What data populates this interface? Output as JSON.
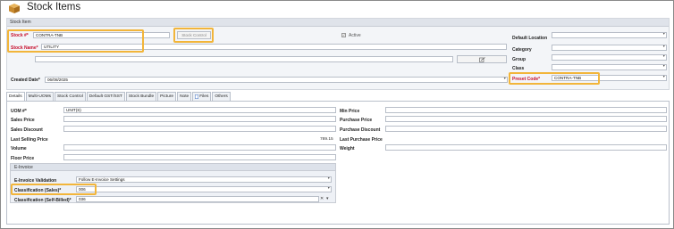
{
  "window": {
    "title": "Stock Items"
  },
  "panel": {
    "header": "Stock Item"
  },
  "fields": {
    "stock_no": {
      "label": "Stock #*",
      "value": "CONTRA-TNB"
    },
    "stock_name": {
      "label": "Stock Name*",
      "value": "UTILITY"
    },
    "stock_control_button": "Stock Control",
    "active": {
      "label": "Active",
      "checked": true
    },
    "created_date": {
      "label": "Created Date*",
      "value": "06/08/2025"
    },
    "default_location": {
      "label": "Default Location",
      "value": ""
    },
    "category": {
      "label": "Category",
      "value": ""
    },
    "group": {
      "label": "Group",
      "value": ""
    },
    "class": {
      "label": "Class",
      "value": ""
    },
    "preset_code": {
      "label": "Preset Code*",
      "value": "CONTRA-TNB"
    }
  },
  "tabs": [
    {
      "label": "Details",
      "active": true
    },
    {
      "label": "Multi-UOMs"
    },
    {
      "label": "Stock Control"
    },
    {
      "label": "Default GST/SST"
    },
    {
      "label": "Stock Bundle"
    },
    {
      "label": "Picture"
    },
    {
      "label": "Note"
    },
    {
      "label": "Files",
      "icon": "file-icon"
    },
    {
      "label": "Others"
    }
  ],
  "details": {
    "left": [
      {
        "label": "UOM #*",
        "value": "UNIT(S)"
      },
      {
        "label": "Sales Price",
        "value": ""
      },
      {
        "label": "Sales Discount",
        "value": ""
      },
      {
        "label": "Last Selling Price",
        "value": "789.15"
      },
      {
        "label": "Volume",
        "value": ""
      },
      {
        "label": "Floor Price",
        "value": ""
      }
    ],
    "right": [
      {
        "label": "Min Price",
        "value": ""
      },
      {
        "label": "Purchase Price",
        "value": ""
      },
      {
        "label": "Purchase Discount",
        "value": ""
      },
      {
        "label": "Last Purchase Price",
        "value": ""
      },
      {
        "label": "Weight",
        "value": ""
      }
    ]
  },
  "einvoice": {
    "header": "E-Invoice",
    "validation": {
      "label": "E-Invoice Validation",
      "value": "Follow E-Invoice Settings"
    },
    "class_sales": {
      "label": "Classification (Sales)*",
      "value": "006"
    },
    "class_self_billed": {
      "label": "Classification (Self-Billed)*",
      "value": "036"
    }
  },
  "colors": {
    "highlight": "#f2b53a",
    "required_label": "#c8102e",
    "panel_bg": "#f3f5f8"
  }
}
